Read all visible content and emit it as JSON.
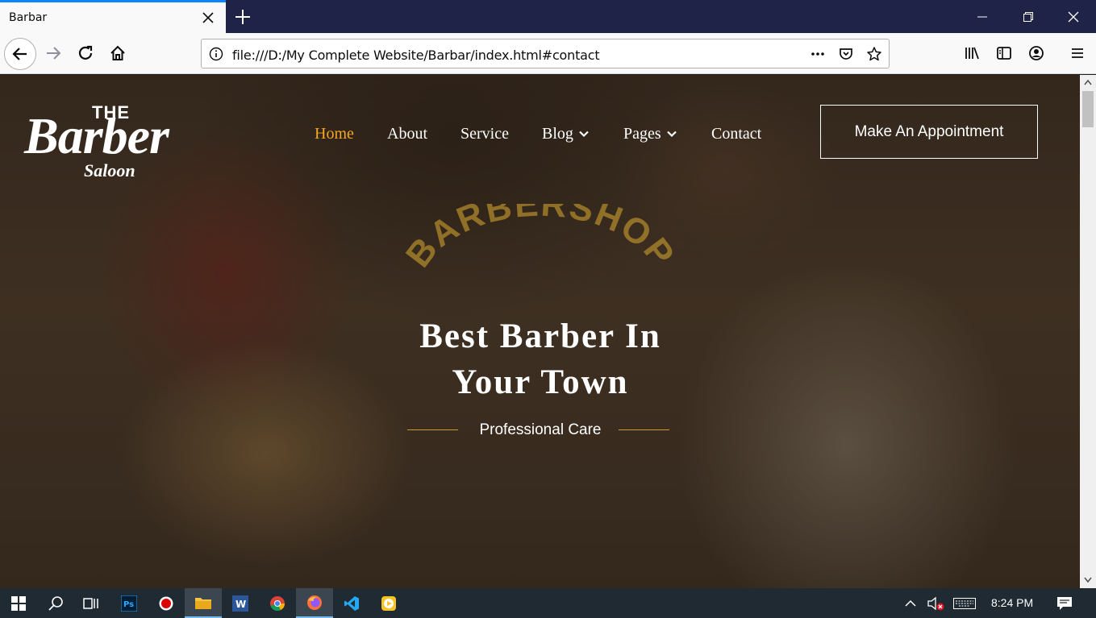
{
  "browser": {
    "tab_title": "Barbar",
    "url": "file:///D:/My Complete Website/Barbar/index.html#contact"
  },
  "site": {
    "logo": {
      "the": "THE",
      "barber": "Barber",
      "saloon": "Saloon"
    },
    "nav": [
      {
        "label": "Home",
        "active": true
      },
      {
        "label": "About"
      },
      {
        "label": "Service"
      },
      {
        "label": "Blog",
        "dropdown": true
      },
      {
        "label": "Pages",
        "dropdown": true
      },
      {
        "label": "Contact"
      }
    ],
    "cta_label": "Make An Appointment",
    "hero": {
      "stamp": "BARBERSHOP",
      "title_line1": "Best Barber In",
      "title_line2": "Your Town",
      "subtitle": "Professional Care"
    },
    "colors": {
      "accent": "#f5a623",
      "line": "#c99a2e",
      "stamp": "#a8822a"
    }
  },
  "taskbar": {
    "clock": "8:24 PM",
    "apps": [
      "windows-start",
      "search",
      "task-view",
      "photoshop",
      "recorder",
      "file-explorer",
      "word",
      "chrome",
      "firefox",
      "vscode",
      "media-player"
    ]
  }
}
